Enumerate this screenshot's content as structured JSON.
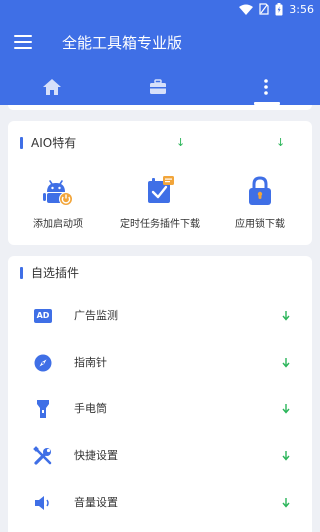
{
  "status": {
    "time": "3:56"
  },
  "app": {
    "title": "全能工具箱专业版"
  },
  "tabs": [
    {
      "icon": "home-icon"
    },
    {
      "icon": "briefcase-icon"
    },
    {
      "icon": "more-vertical-icon",
      "selected": true
    }
  ],
  "aio": {
    "title": "AIO特有",
    "items": [
      {
        "label": "添加启动项",
        "icon": "android-power-icon",
        "download": false
      },
      {
        "label": "定时任务插件下载",
        "icon": "scheduled-task-icon",
        "download": true,
        "download_glyph": "↓"
      },
      {
        "label": "应用锁下载",
        "icon": "app-lock-icon",
        "download": true,
        "download_glyph": "↓"
      }
    ]
  },
  "plugins": {
    "title": "自选插件",
    "items": [
      {
        "label": "广告监测",
        "icon": "ad-icon",
        "icon_text": "AD",
        "action": "↓"
      },
      {
        "label": "指南针",
        "icon": "compass-icon",
        "action": "↓"
      },
      {
        "label": "手电筒",
        "icon": "flashlight-icon",
        "action": "↓"
      },
      {
        "label": "快捷设置",
        "icon": "tools-icon",
        "action": "↓"
      },
      {
        "label": "音量设置",
        "icon": "speaker-icon",
        "action": "↓"
      }
    ]
  },
  "colors": {
    "primary": "#3f6fe6",
    "download": "#2bb55a",
    "background": "#eef0f5"
  }
}
